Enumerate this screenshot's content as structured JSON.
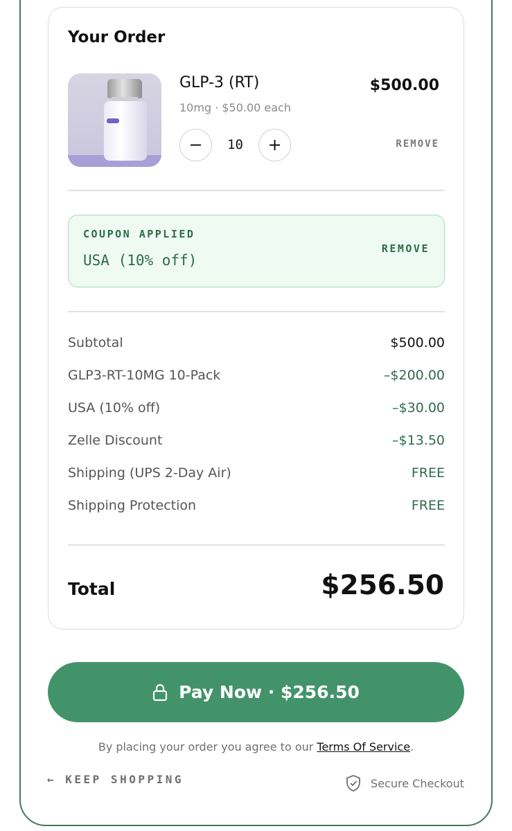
{
  "order": {
    "title": "Your Order",
    "item": {
      "name": "GLP-3 (RT)",
      "subtitle": "10mg · $50.00 each",
      "price": "$500.00",
      "quantity": "10",
      "minus_symbol": "−",
      "plus_symbol": "+",
      "remove_label": "REMOVE",
      "image_icon": "product-vial-image"
    },
    "coupon": {
      "label": "COUPON APPLIED",
      "code": "USA (10% off)",
      "remove_label": "REMOVE"
    },
    "summary": [
      {
        "label": "Subtotal",
        "value": "$500.00"
      },
      {
        "label": "GLP3-RT-10MG 10-Pack",
        "value": "–$200.00"
      },
      {
        "label": "USA (10% off)",
        "value": "–$30.00"
      },
      {
        "label": "Zelle Discount",
        "value": "–$13.50"
      },
      {
        "label": "Shipping (UPS 2-Day Air)",
        "value": "FREE"
      },
      {
        "label": "Shipping Protection",
        "value": "FREE"
      }
    ],
    "total_label": "Total",
    "total_value": "$256.50"
  },
  "pay_button": {
    "label": "Pay Now · $256.50",
    "icon": "lock-icon"
  },
  "terms": {
    "prefix": "By placing your order you agree to our ",
    "link": "Terms Of Service",
    "suffix": "."
  },
  "footer": {
    "keep_shopping": "← KEEP SHOPPING",
    "secure_checkout": "Secure Checkout",
    "secure_icon": "shield-check-icon"
  },
  "colors": {
    "accent_green": "#43936a",
    "text_green": "#2f6b4a",
    "coupon_bg": "#eefaf2",
    "frame_border": "#3f7a57"
  }
}
